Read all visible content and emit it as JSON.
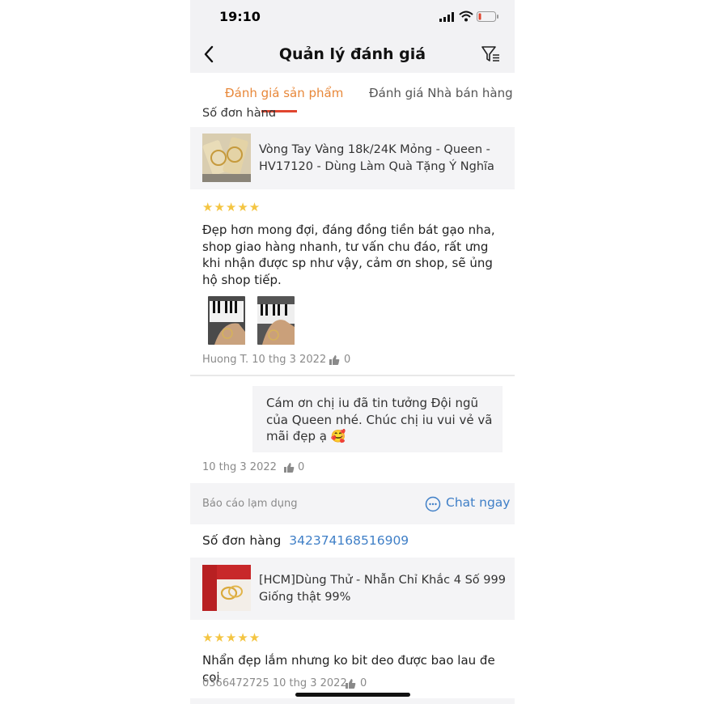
{
  "status": {
    "time": "19:10"
  },
  "header": {
    "title": "Quản lý đánh giá"
  },
  "tabs": [
    {
      "label": "Đánh giá sản phẩm",
      "active": true
    },
    {
      "label": "Đánh giá Nhà bán hàng",
      "active": false
    }
  ],
  "reviews": [
    {
      "order_label": "Số đơn hàng",
      "order_number": "...",
      "product_name": "Vòng Tay Vàng 18k/24K Mỏng - Queen - HV17120 - Dùng Làm Quà Tặng Ý Nghĩa V...",
      "stars": "★★★★★",
      "text": "Đẹp hơn mong đợi, đáng đồng tiền bát gạo nha, shop giao hàng nhanh, tư vấn chu đáo, rất ưng khi nhận được sp như vậy, cảm ơn shop, sẽ ủng hộ shop tiếp.",
      "author_date": "Huong T. 10 thg 3 2022",
      "likes": "0",
      "reply": {
        "text": "Cám ơn chị iu đã tin tưởng Đội ngũ của Queen nhé. Chúc chị iu vui vẻ vã mãi đẹp ạ 🥰",
        "date": "10 thg 3 2022",
        "likes": "0"
      },
      "report_label": "Báo cáo lạm dụng",
      "chat_label": "Chat ngay"
    },
    {
      "order_label": "Số đơn hàng",
      "order_number": "342374168516909",
      "product_name": "[HCM]Dùng Thử - Nhẫn Chỉ Khắc 4 Số 999 Giống thật 99%",
      "stars": "★★★★★",
      "text": "Nhẩn đẹp lắm nhưng ko bit deo được bao lau đe coi",
      "author_date": "0366472725 10 thg 3 2022",
      "likes": "0"
    }
  ],
  "colors": {
    "accent": "#e8883a",
    "link": "#3f7fc7",
    "star": "#f4c542"
  }
}
